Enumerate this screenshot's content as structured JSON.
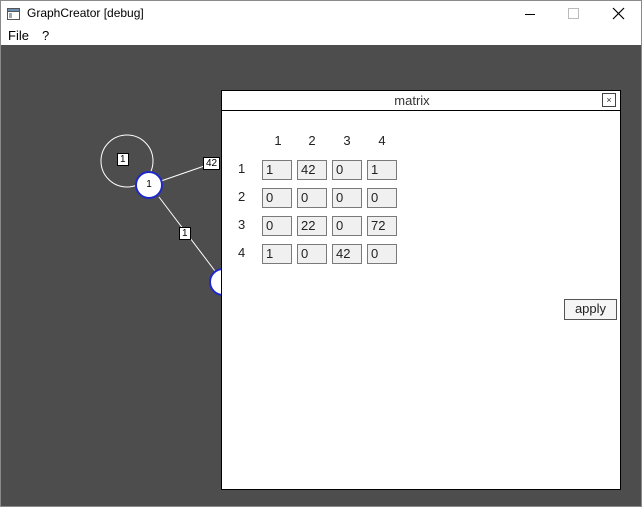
{
  "window": {
    "title": "GraphCreator [debug]",
    "icons": {
      "app": "app-window-icon",
      "minimize": "minimize-icon",
      "maximize": "maximize-icon",
      "close": "close-icon"
    }
  },
  "menubar": {
    "items": [
      "File",
      "?"
    ]
  },
  "graph": {
    "nodes": [
      "1",
      "1"
    ],
    "edge_labels": [
      "1",
      "42",
      "1"
    ]
  },
  "matrix_dialog": {
    "title": "matrix",
    "close_label": "×",
    "column_headers": [
      "1",
      "2",
      "3",
      "4"
    ],
    "row_headers": [
      "1",
      "2",
      "3",
      "4"
    ],
    "values": [
      [
        "1",
        "42",
        "0",
        "1"
      ],
      [
        "0",
        "0",
        "0",
        "0"
      ],
      [
        "0",
        "22",
        "0",
        "72"
      ],
      [
        "1",
        "0",
        "42",
        "0"
      ]
    ],
    "apply_label": "apply"
  },
  "colors": {
    "canvas_bg": "#4d4d4d",
    "node_border": "#1e28c8",
    "edge": "#ffffff"
  }
}
